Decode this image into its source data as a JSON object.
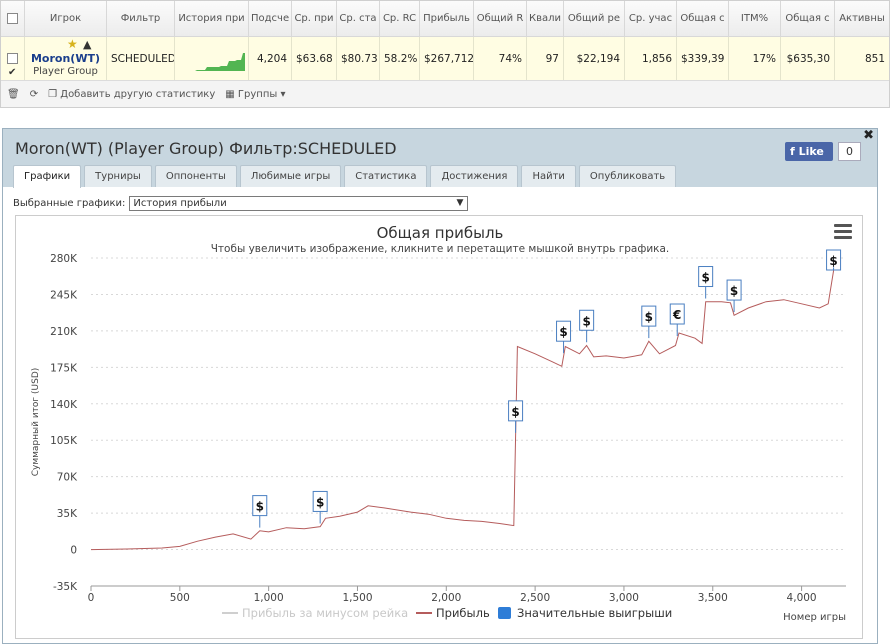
{
  "table": {
    "headers": [
      "Игрок",
      "Фильтр",
      "История при",
      "Подсче",
      "Ср. при",
      "Ср. ста",
      "Ср. RC",
      "Прибыль",
      "Общий R",
      "Квали",
      "Общий ре",
      "Ср. учас",
      "Общая с",
      "ITM%",
      "Общая с",
      "Активны"
    ],
    "row": {
      "player_name": "Moron(WT)",
      "player_group": "Player Group",
      "filter": "SCHEDULED",
      "cells": [
        "4,204",
        "$63.68",
        "$80.73",
        "58.2%",
        "$267,712",
        "74%",
        "97",
        "$22,194",
        "1,856",
        "$339,39",
        "17%",
        "$635,30",
        "851"
      ]
    }
  },
  "toolbar": {
    "add_stat": "Добавить другую статистику",
    "groups": "Группы"
  },
  "panel": {
    "title": "Moron(WT) (Player Group) Фильтр:SCHEDULED",
    "like_label": "Like",
    "like_count": "0",
    "tabs": [
      "Графики",
      "Турниры",
      "Оппоненты",
      "Любимые игры",
      "Статистика",
      "Достижения",
      "Найти",
      "Опубликовать"
    ],
    "selector_label": "Выбранные графики:",
    "selector_value": "История прибыли"
  },
  "chart_data": {
    "type": "line",
    "title": "Общая прибыль",
    "subtitle": "Чтобы увеличить изображение, кликните и перетащите мышкой внутрь графика.",
    "ylabel": "Суммарный итог (USD)",
    "xlabel": "Номер игры",
    "ylim": [
      -35000,
      280000
    ],
    "xlim": [
      0,
      4250
    ],
    "yticks": [
      "280K",
      "245K",
      "210K",
      "175K",
      "140K",
      "105K",
      "70K",
      "35K",
      "0",
      "-35K"
    ],
    "xticks": [
      "0",
      "500",
      "1,000",
      "1,500",
      "2,000",
      "2,500",
      "3,000",
      "3,500",
      "4,000"
    ],
    "legend": [
      "Прибыль за минусом рейка",
      "Прибыль",
      "Значительные выигрыши"
    ],
    "series_color": "#b55c5c",
    "x": [
      0,
      200,
      400,
      500,
      600,
      700,
      800,
      900,
      950,
      1000,
      1100,
      1200,
      1290,
      1320,
      1400,
      1500,
      1560,
      1650,
      1800,
      1900,
      2000,
      2100,
      2200,
      2300,
      2380,
      2400,
      2500,
      2600,
      2650,
      2670,
      2750,
      2790,
      2830,
      2900,
      3000,
      3100,
      3140,
      3200,
      3290,
      3310,
      3400,
      3440,
      3460,
      3550,
      3600,
      3620,
      3700,
      3800,
      3900,
      4000,
      4100,
      4150,
      4180
    ],
    "y": [
      0,
      500,
      1500,
      3000,
      8000,
      12000,
      15000,
      10000,
      18000,
      17000,
      21000,
      20000,
      22000,
      30000,
      32000,
      36000,
      42000,
      40000,
      36000,
      34000,
      30000,
      28000,
      27000,
      25000,
      23000,
      195000,
      188000,
      180000,
      176000,
      195000,
      188000,
      196000,
      185000,
      186000,
      184000,
      187000,
      200000,
      188000,
      196000,
      208000,
      203000,
      198000,
      238000,
      238000,
      237000,
      225000,
      232000,
      238000,
      240000,
      236000,
      232000,
      236000,
      268000
    ],
    "big_wins": [
      {
        "x": 950,
        "symbol": "$"
      },
      {
        "x": 1290,
        "symbol": "$"
      },
      {
        "x": 2390,
        "symbol": "$"
      },
      {
        "x": 2660,
        "symbol": "$"
      },
      {
        "x": 2790,
        "symbol": "$"
      },
      {
        "x": 3140,
        "symbol": "$"
      },
      {
        "x": 3300,
        "symbol": "€"
      },
      {
        "x": 3460,
        "symbol": "$"
      },
      {
        "x": 3620,
        "symbol": "$"
      },
      {
        "x": 4180,
        "symbol": "$"
      }
    ]
  },
  "colors": {
    "win_flag_border": "#4a7fc1",
    "legend_wins": "#2e7dd7",
    "grid": "#d8d8d8"
  }
}
